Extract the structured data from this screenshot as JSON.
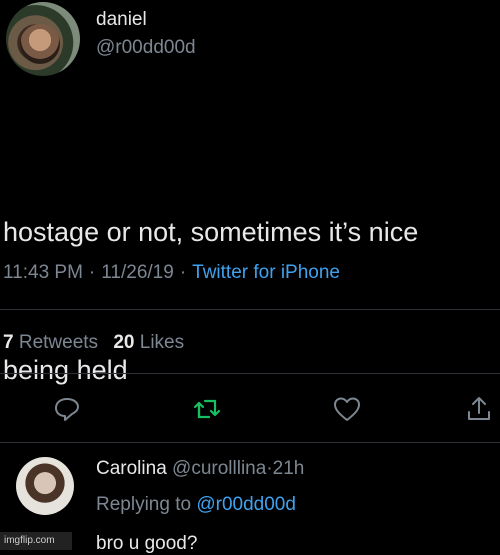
{
  "tweet": {
    "author_name": "daniel",
    "author_handle": "@r00dd00d",
    "text_line1": "hostage or not, sometimes it’s nice",
    "text_line2": "being held",
    "time": "11:43 PM",
    "date": "11/26/19",
    "separator": "·",
    "source": "Twitter for iPhone",
    "retweets_count": "7",
    "retweets_label": "Retweets",
    "likes_count": "20",
    "likes_label": "Likes"
  },
  "actions": [
    {
      "name": "reply",
      "icon": "reply-icon"
    },
    {
      "name": "retweet",
      "icon": "retweet-icon"
    },
    {
      "name": "like",
      "icon": "heart-icon"
    },
    {
      "name": "share",
      "icon": "share-icon"
    }
  ],
  "reply": {
    "author_name": "Carolina",
    "author_handle": "@curolllina",
    "separator": "·",
    "age": "21h",
    "replying_to_label": "Replying to",
    "replying_to_handle": "@r00dd00d",
    "text": "bro u good?"
  },
  "watermark": "imgflip.com",
  "colors": {
    "background": "#000000",
    "text": "#e8e8e8",
    "muted": "#7d8792",
    "link": "#3fa2ef",
    "retweet_green": "#17bf63"
  }
}
